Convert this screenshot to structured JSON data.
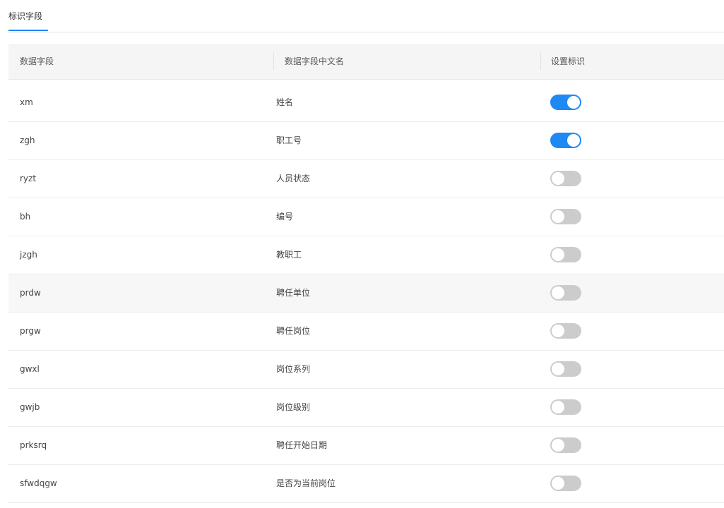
{
  "tabs": [
    {
      "label": "标识字段",
      "active": true
    }
  ],
  "accent_color": "#1e88f5",
  "table": {
    "headers": [
      "数据字段",
      "数据字段中文名",
      "设置标识"
    ],
    "rows": [
      {
        "field": "xm",
        "name": "姓名",
        "flag": true
      },
      {
        "field": "zgh",
        "name": "职工号",
        "flag": true
      },
      {
        "field": "ryzt",
        "name": "人员状态",
        "flag": false
      },
      {
        "field": "bh",
        "name": "编号",
        "flag": false
      },
      {
        "field": "jzgh",
        "name": "教职工",
        "flag": false
      },
      {
        "field": "prdw",
        "name": "聘任单位",
        "flag": false
      },
      {
        "field": "prgw",
        "name": "聘任岗位",
        "flag": false
      },
      {
        "field": "gwxl",
        "name": "岗位系列",
        "flag": false
      },
      {
        "field": "gwjb",
        "name": "岗位级别",
        "flag": false
      },
      {
        "field": "prksrq",
        "name": "聘任开始日期",
        "flag": false
      },
      {
        "field": "sfwdqgw",
        "name": "是否为当前岗位",
        "flag": false
      }
    ]
  }
}
